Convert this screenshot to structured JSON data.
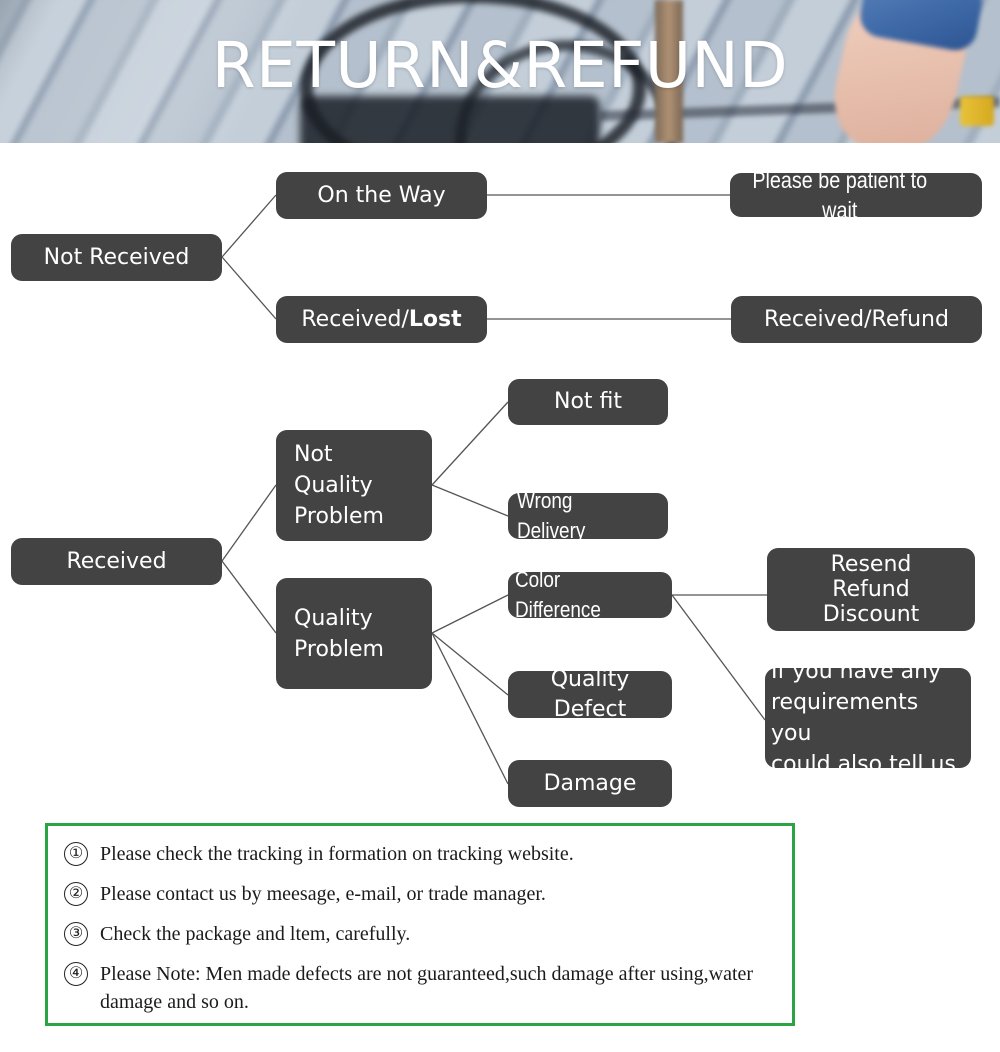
{
  "banner": {
    "title": "RETURN&REFUND"
  },
  "colors": {
    "node_bg": "#434343",
    "node_text": "#ffffff",
    "connector": "#555555",
    "notes_border": "#2ba544",
    "notes_text": "#1b1b1b",
    "banner_title": "#ffffff"
  },
  "flowchart": {
    "nodes": {
      "not_received": "Not Received",
      "on_the_way": "On the Way",
      "received_lost_prefix": "Received/",
      "received_lost_bold": "Lost",
      "please_be_patient": "Please be patient to wait",
      "received_refund": "Received/Refund",
      "received": "Received",
      "not_quality_problem": "Not\nQuality\nProblem",
      "quality_problem": "Quality\nProblem",
      "not_fit": "Not fit",
      "wrong_delivery": "Wrong Delivery",
      "color_difference": "Color Difference",
      "quality_defect": "Quality Defect",
      "damage": "Damage",
      "resend_refund_discount": "Resend\nRefund\nDiscount",
      "if_you_have_any": "If you have any\nrequirements you\ncould also tell us"
    }
  },
  "notes": {
    "items": [
      {
        "num": "①",
        "text": "Please check the tracking in formation on tracking website."
      },
      {
        "num": "②",
        "text": "Please contact us by meesage, e-mail, or trade manager."
      },
      {
        "num": "③",
        "text": "Check the package and ltem, carefully."
      },
      {
        "num": "④",
        "text": "Please Note: Men made defects  are not guaranteed,such damage after using,water damage and so on."
      }
    ]
  }
}
